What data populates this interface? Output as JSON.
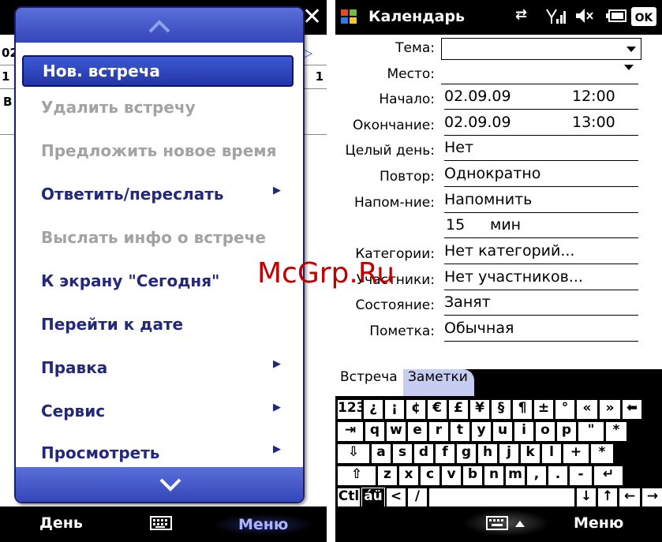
{
  "left": {
    "background": {
      "row_text_1": "02",
      "row_text_2": "1",
      "row_text_3": "B",
      "right_marker": "1"
    },
    "menu": {
      "items": [
        {
          "label": "Нов. встреча",
          "state": "selected",
          "submenu": false
        },
        {
          "label": "Удалить встречу",
          "state": "disabled",
          "submenu": false
        },
        {
          "label": "Предложить новое время",
          "state": "disabled",
          "submenu": false
        },
        {
          "label": "Ответить/переслать",
          "state": "enabled",
          "submenu": true
        },
        {
          "label": "Выслать инфо о встрече",
          "state": "disabled",
          "submenu": false
        },
        {
          "label": "К экрану \"Сегодня\"",
          "state": "enabled",
          "submenu": false
        },
        {
          "label": "Перейти к дате",
          "state": "enabled",
          "submenu": false
        },
        {
          "label": "Правка",
          "state": "enabled",
          "submenu": true
        },
        {
          "label": "Сервис",
          "state": "enabled",
          "submenu": true
        },
        {
          "label": "Просмотреть",
          "state": "enabled",
          "submenu": true
        }
      ]
    },
    "softkeys": {
      "left": "День",
      "right": "Меню"
    }
  },
  "right": {
    "title": "Календарь",
    "form": {
      "subject_label": "Тема:",
      "location_label": "Место:",
      "start_label": "Начало:",
      "start_date": "02.09.09",
      "start_time": "12:00",
      "end_label": "Окончание:",
      "end_date": "02.09.09",
      "end_time": "13:00",
      "allday_label": "Целый день:",
      "allday_value": "Нет",
      "repeat_label": "Повтор:",
      "repeat_value": "Однократно",
      "reminder_label": "Напом-ние:",
      "reminder_value": "Напомнить",
      "reminder_amount": "15",
      "reminder_unit": "мин",
      "categories_label": "Категории:",
      "categories_value": "Нет категорий...",
      "attendees_label": "Участники:",
      "attendees_value": "Нет участников...",
      "status_label": "Состояние:",
      "status_value": "Занят",
      "sensitivity_label": "Пометка:",
      "sensitivity_value": "Обычная"
    },
    "tabs": {
      "appointment": "Встреча",
      "notes": "Заметки"
    },
    "keyboard": {
      "row1": [
        "123",
        "¿",
        "¡",
        "¢",
        "€",
        "£",
        "¥",
        "§",
        "¶",
        "±",
        "°",
        "«",
        "»",
        "⬅"
      ],
      "row2": [
        "⇥",
        "q",
        "w",
        "e",
        "r",
        "t",
        "y",
        "u",
        "i",
        "o",
        "p",
        "\"",
        "*"
      ],
      "row3": [
        "⇩",
        "a",
        "s",
        "d",
        "f",
        "g",
        "h",
        "j",
        "k",
        "l",
        "+",
        "*"
      ],
      "row4": [
        "⇧",
        "z",
        "x",
        "c",
        "v",
        "b",
        "n",
        "m",
        ",",
        ".",
        "-",
        "↵"
      ],
      "row5": [
        "Ctl",
        "áü",
        "<",
        "/",
        "",
        "↓",
        "↑",
        "←",
        "→"
      ]
    },
    "softkeys": {
      "right": "Меню"
    }
  },
  "watermark": "McGrp.Ru"
}
